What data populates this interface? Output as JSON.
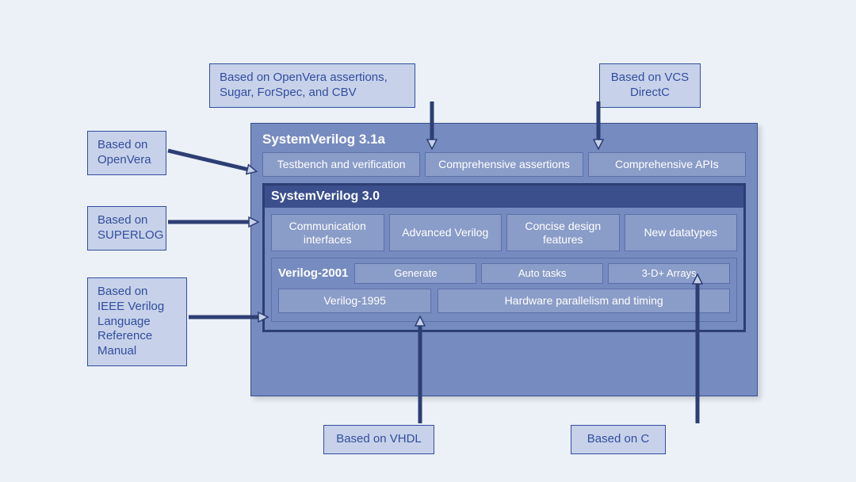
{
  "callouts": {
    "openvera_assertions": "Based on OpenVera  assertions, Sugar, ForSpec, and CBV",
    "vcs_directc": "Based on VCS  DirectC",
    "openvera": "Based on OpenVera",
    "superlog": "Based on SUPERLOG",
    "ieee_verilog": "Based on IEEE Verilog Language Reference Manual",
    "vhdl": "Based on VHDL",
    "c": "Based on C"
  },
  "layers": {
    "sv31a": {
      "title": "SystemVerilog 3.1a",
      "features": [
        "Testbench and verification",
        "Comprehensive assertions",
        "Comprehensive APIs"
      ]
    },
    "sv30": {
      "title": "SystemVerilog 3.0",
      "features": [
        "Communication interfaces",
        "Advanced Verilog",
        "Concise design features",
        "New datatypes"
      ]
    },
    "v2001": {
      "title": "Verilog-2001",
      "features": [
        "Generate",
        "Auto tasks",
        "3-D+ Arrays"
      ]
    },
    "v1995": {
      "name": "Verilog-1995",
      "desc": "Hardware parallelism and timing"
    }
  }
}
